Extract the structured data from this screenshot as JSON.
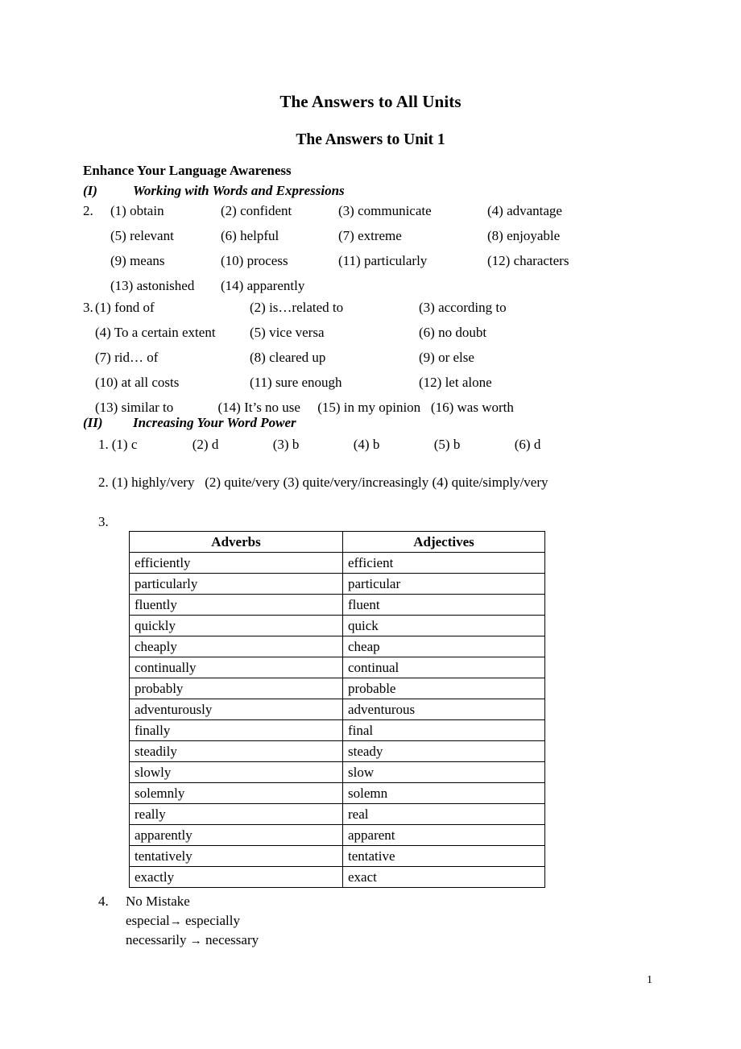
{
  "document": {
    "title": "The Answers to All Units",
    "unit_title": "The Answers to Unit 1",
    "section_heading": "Enhance Your Language Awareness",
    "page_number": "1"
  },
  "section_I": {
    "numeral": "(I)",
    "heading": "Working with Words and Expressions",
    "item2": {
      "lead": "2.",
      "answers": [
        "(1) obtain",
        "(2) confident",
        "(3) communicate",
        "(4) advantage",
        "(5) relevant",
        "(6) helpful",
        "(7) extreme",
        "(8) enjoyable",
        "(9) means",
        "(10) process",
        "(11) particularly",
        "(12) characters",
        "(13) astonished",
        "(14) apparently",
        "",
        ""
      ]
    },
    "item3": {
      "lead": "3.",
      "answers": [
        "(1) fond of",
        "(2) is…related to",
        "(3) according to",
        "(4) To a certain extent",
        "(5) vice versa",
        "(6) no doubt",
        "(7) rid… of",
        " (8) cleared up",
        " (9) or else",
        "(10) at all costs",
        " (11) sure enough",
        "  (12) let alone"
      ],
      "last_row": "(13) similar to             (14) It’s no use     (15) in my opinion   (16) was worth"
    }
  },
  "section_II": {
    "numeral": "(II)",
    "heading": "Increasing Your Word Power",
    "item1": {
      "lead": "1.",
      "answers": [
        "(1) c",
        "(2) d",
        "(3) b",
        "(4) b",
        "(5) b",
        "(6) d"
      ]
    },
    "item2": {
      "text": "2. (1) highly/very   (2) quite/very (3) quite/very/increasingly (4) quite/simply/very"
    },
    "item3": {
      "lead": "3.",
      "table": {
        "headers": [
          "Adverbs",
          "Adjectives"
        ],
        "rows": [
          [
            "efficiently",
            "efficient"
          ],
          [
            "particularly",
            "particular"
          ],
          [
            "fluently",
            "fluent"
          ],
          [
            "quickly",
            "quick"
          ],
          [
            "cheaply",
            "cheap"
          ],
          [
            "continually",
            "continual"
          ],
          [
            "probably",
            "probable"
          ],
          [
            "adventurously",
            "adventurous"
          ],
          [
            "finally",
            "final"
          ],
          [
            "steadily",
            "steady"
          ],
          [
            "slowly",
            "slow"
          ],
          [
            "solemnly",
            "solemn"
          ],
          [
            "really",
            "real"
          ],
          [
            "apparently",
            "apparent"
          ],
          [
            "tentatively",
            "tentative"
          ],
          [
            "exactly",
            "exact"
          ]
        ]
      }
    },
    "item4": {
      "lead": "4.",
      "title": "No Mistake",
      "corrections": [
        {
          "wrong": "especial",
          "arrow": "→",
          "right": " especially",
          "gap": ""
        },
        {
          "wrong": "necessarily",
          "arrow": "→",
          "right": " necessary",
          "gap": " "
        }
      ]
    }
  }
}
